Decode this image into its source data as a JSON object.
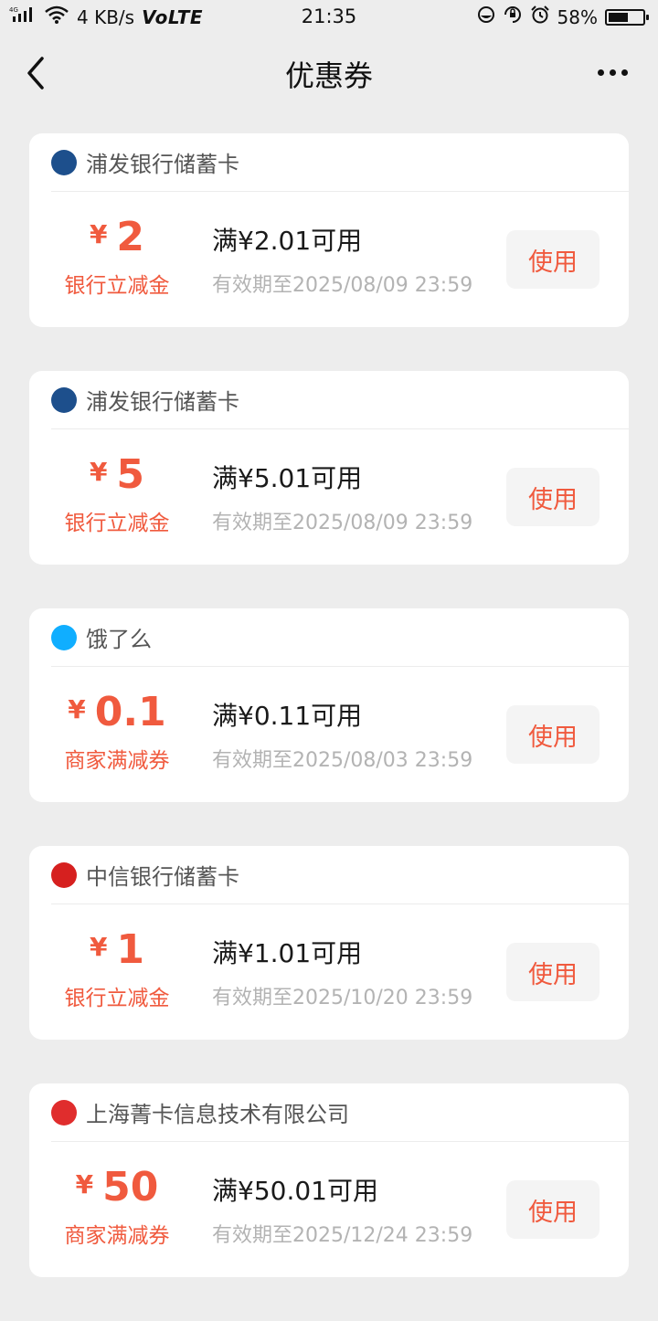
{
  "status_bar": {
    "network": "4G",
    "speed": "4 KB/s",
    "volte": "VoLTE",
    "time": "21:35",
    "battery": "58%",
    "battery_level": 58
  },
  "header": {
    "title": "优惠券"
  },
  "coupons": [
    {
      "merchant": "浦发银行储蓄卡",
      "logo": "spdb-logo-icon",
      "logo_color": "#1d4f8c",
      "currency": "¥",
      "amount": "2",
      "type": "银行立减金",
      "condition": "满¥2.01可用",
      "expiry": "有效期至2025/08/09 23:59",
      "button": "使用"
    },
    {
      "merchant": "浦发银行储蓄卡",
      "logo": "spdb-logo-icon",
      "logo_color": "#1d4f8c",
      "currency": "¥",
      "amount": "5",
      "type": "银行立减金",
      "condition": "满¥5.01可用",
      "expiry": "有效期至2025/08/09 23:59",
      "button": "使用"
    },
    {
      "merchant": "饿了么",
      "logo": "eleme-logo-icon",
      "logo_color": "#10aeff",
      "currency": "¥",
      "amount": "0.1",
      "type": "商家满减券",
      "condition": "满¥0.11可用",
      "expiry": "有效期至2025/08/03 23:59",
      "button": "使用"
    },
    {
      "merchant": "中信银行储蓄卡",
      "logo": "citic-logo-icon",
      "logo_color": "#d6201f",
      "currency": "¥",
      "amount": "1",
      "type": "银行立减金",
      "condition": "满¥1.01可用",
      "expiry": "有效期至2025/10/20 23:59",
      "button": "使用"
    },
    {
      "merchant": "上海菁卡信息技术有限公司",
      "logo": "jingka-logo-icon",
      "logo_color": "#e02d2d",
      "currency": "¥",
      "amount": "50",
      "type": "商家满减券",
      "condition": "满¥50.01可用",
      "expiry": "有效期至2025/12/24 23:59",
      "button": "使用"
    }
  ],
  "colors": {
    "accent": "#f05a3e",
    "background": "#ededed",
    "card": "#ffffff",
    "muted_text": "#b3b3b3"
  }
}
